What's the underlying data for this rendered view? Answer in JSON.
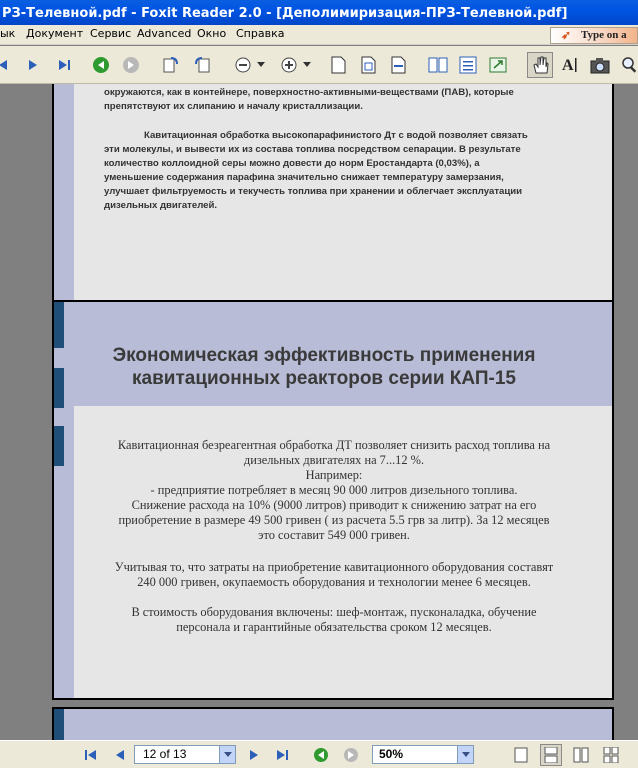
{
  "window": {
    "title": "РЗ-Телевной.pdf - Foxit Reader 2.0 - [Деполимиризация-ПРЗ-Телевной.pdf]"
  },
  "menu": {
    "items": [
      "ык",
      "Документ",
      "Сервис",
      "Advanced",
      "Окно",
      "Справка"
    ],
    "type_box": "Type on a"
  },
  "slide1": {
    "line1": "окружаются, как в контейнере, поверхностно-активными-веществами (ПАВ), которые",
    "line2": "препятствуют их слипанию и началу кристаллизации.",
    "para2": [
      "Кавитационная обработка высокопарафинистого Дт с водой позволяет связать",
      "эти молекулы, и вывести их из состава топлива посредством сепарации. В результате",
      "количество коллоидной серы можно довести до норм Еростандарта (0,03%), а",
      "уменьшение содержания парафина значительно снижает температуру замерзания,",
      "улучшает фильтруемость и текучесть  топлива при хранении и облегчает эксплуатации",
      "дизельных двигателей."
    ]
  },
  "slide2": {
    "title_line1": "Экономическая эффективность применения",
    "title_line2": "кавитационных реакторов серии КАП-15",
    "body": [
      "Кавитационная безреагентная обработка ДТ позволяет снизить расход топлива на",
      "дизельных двигателях на 7...12 %.",
      "Например:",
      "- предприятие потребляет в месяц 90 000 литров дизельного топлива.",
      "Снижение расхода на 10% (9000 литров) приводит к снижению затрат на его",
      "приобретение в размере 49 500 гривен ( из расчета 5.5 грв за литр). За 12 месяцев",
      "это составит 549 000 гривен."
    ],
    "body2": [
      "Учитывая то, что затраты на приобретение кавитационного оборудования составят",
      "240 000 гривен, окупаемость оборудования и технологии менее 6 месяцев."
    ],
    "body3": [
      "В стоимость оборудования включены: шеф-монтаж, пусконаладка, обучение",
      "персонала и гарантийные обязательства сроком 12 месяцев."
    ]
  },
  "navbar": {
    "page": "12 of 13",
    "zoom": "50%"
  }
}
